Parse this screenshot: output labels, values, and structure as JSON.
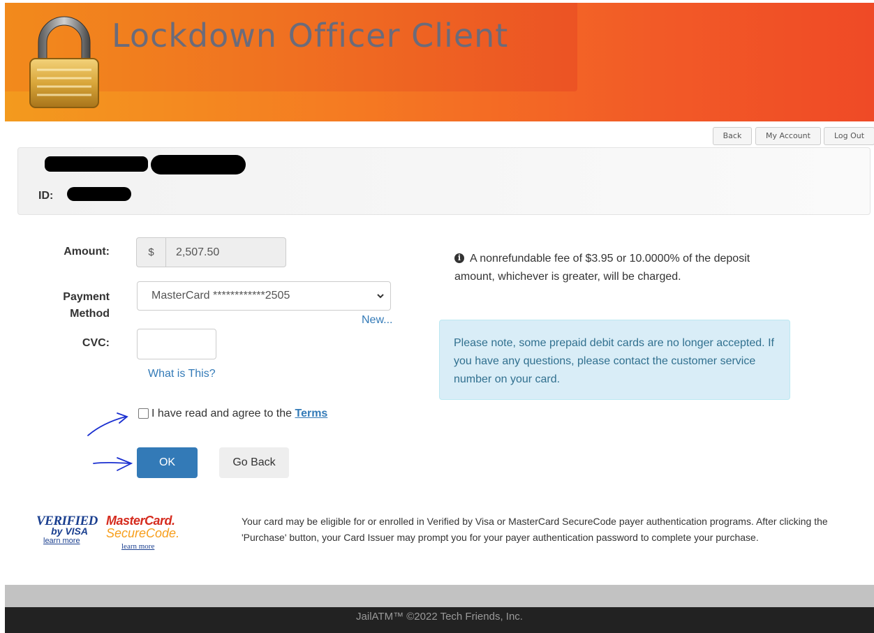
{
  "header": {
    "title": "Lockdown Officer Client"
  },
  "top_nav": {
    "back": "Back",
    "my_account": "My Account",
    "log_out": "Log Out"
  },
  "user": {
    "id_label": "ID:"
  },
  "form": {
    "amount_label": "Amount:",
    "currency_symbol": "$",
    "amount_value": "2,507.50",
    "payment_method_label_line1": "Payment",
    "payment_method_label_line2": "Method",
    "payment_method_value": "MasterCard ************2505",
    "new_link": "New...",
    "cvc_label": "CVC:",
    "cvc_value": "",
    "what_is_this": "What is This?",
    "terms_prefix": "I have read and agree to the ",
    "terms_link": "Terms",
    "terms_checked": false,
    "ok_button": "OK",
    "go_back_button": "Go Back"
  },
  "fee_notice": "A nonrefundable fee of $3.95 or 10.0000% of the deposit amount, whichever is greater, will be charged.",
  "prepaid_notice": "Please note, some prepaid debit cards are no longer accepted. If you have any questions, please contact the customer service number on your card.",
  "card_logos": {
    "vbv_line1": "VERIFIED",
    "vbv_line2": "by VISA",
    "vbv_learn": "learn more",
    "mc_line1": "MasterCard.",
    "mc_line2": "SecureCode.",
    "mc_learn": "learn more"
  },
  "secure_text": "Your card may be eligible for or enrolled in Verified by Visa or MasterCard SecureCode payer authentication programs. After clicking the 'Purchase' button, your Card Issuer may prompt you for your payer authentication password to complete your purchase.",
  "footer": "JailATM™ ©2022 Tech Friends, Inc.",
  "colors": {
    "primary": "#337ab7",
    "header_orange": "#f57a22",
    "notice_bg": "#d9edf7",
    "footer_bg": "#222222"
  }
}
